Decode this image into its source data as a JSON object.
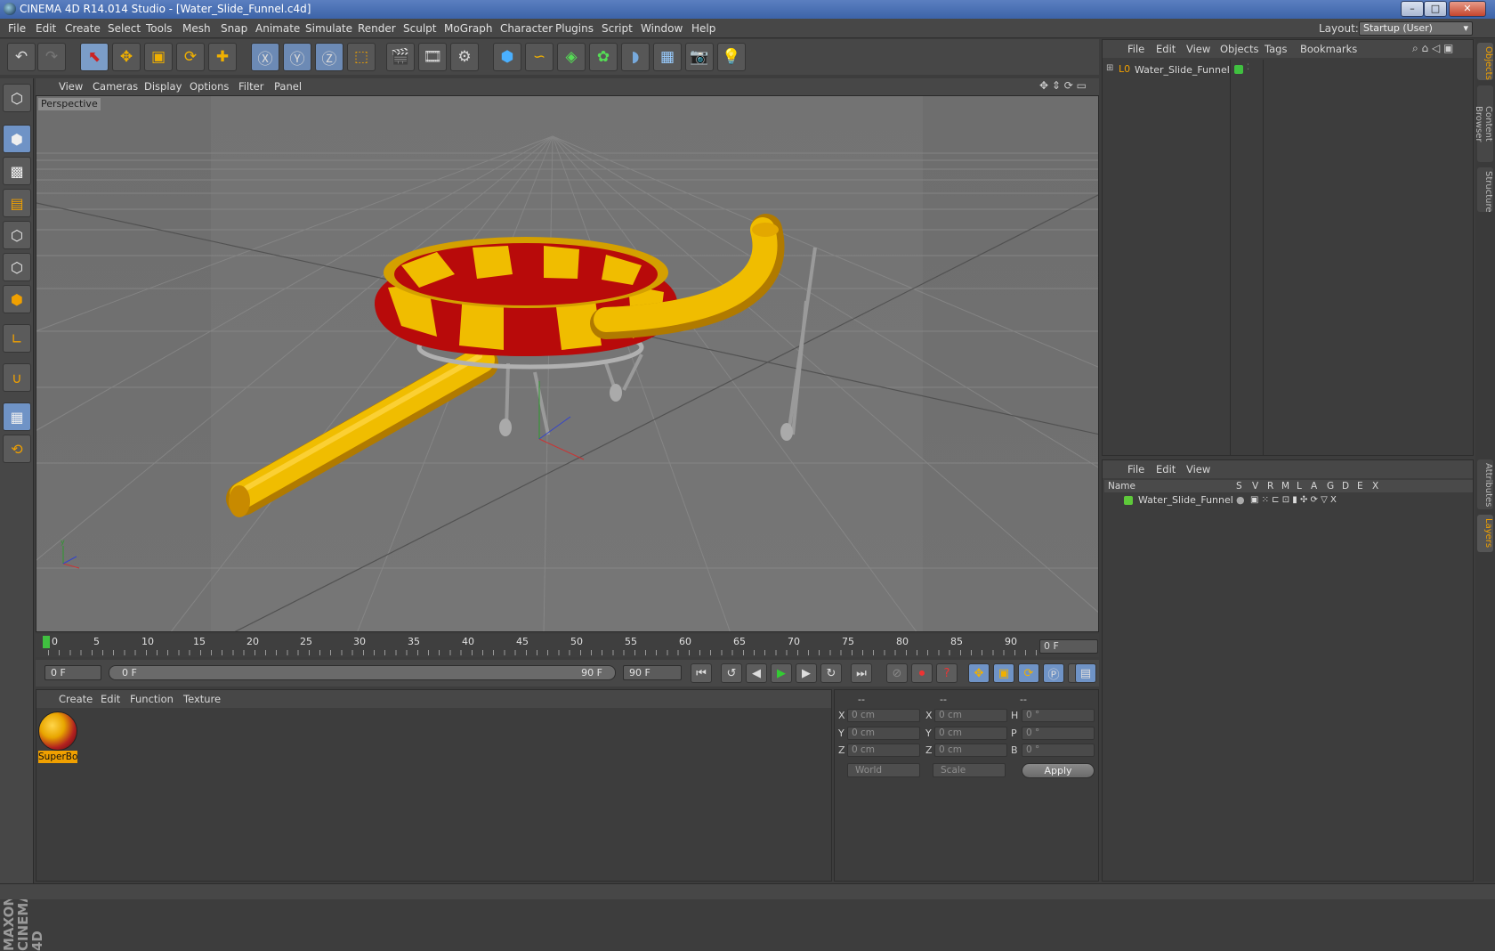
{
  "window": {
    "title": "CINEMA 4D R14.014 Studio - [Water_Slide_Funnel.c4d]",
    "minimize": "–",
    "maximize": "□",
    "close": "✕"
  },
  "menubar": {
    "items": [
      "File",
      "Edit",
      "Create",
      "Select",
      "Tools",
      "Mesh",
      "Snap",
      "Animate",
      "Simulate",
      "Render",
      "Sculpt",
      "MoGraph",
      "Character",
      "Plugins",
      "Script",
      "Window",
      "Help"
    ],
    "layout_label": "Layout:",
    "layout_value": "Startup (User)"
  },
  "viewport": {
    "menu": [
      "View",
      "Cameras",
      "Display",
      "Options",
      "Filter",
      "Panel"
    ],
    "label": "Perspective"
  },
  "timeline": {
    "ticks": [
      "0",
      "5",
      "10",
      "15",
      "20",
      "25",
      "30",
      "35",
      "40",
      "45",
      "50",
      "55",
      "60",
      "65",
      "70",
      "75",
      "80",
      "85",
      "90"
    ],
    "current_frame_right": "0 F"
  },
  "transport": {
    "start_frame": "0 F",
    "range_start": "0 F",
    "range_end": "90 F",
    "end_frame": "90 F"
  },
  "material_manager": {
    "menu": [
      "Create",
      "Edit",
      "Function",
      "Texture"
    ],
    "materials": [
      {
        "name": "SuperBo"
      }
    ]
  },
  "coordinates": {
    "col1_header": "--",
    "col2_header": "--",
    "col3_header": "--",
    "rows": [
      {
        "l1": "X",
        "v1": "0 cm",
        "l2": "X",
        "v2": "0 cm",
        "l3": "H",
        "v3": "0 °"
      },
      {
        "l1": "Y",
        "v1": "0 cm",
        "l2": "Y",
        "v2": "0 cm",
        "l3": "P",
        "v3": "0 °"
      },
      {
        "l1": "Z",
        "v1": "0 cm",
        "l2": "Z",
        "v2": "0 cm",
        "l3": "B",
        "v3": "0 °"
      }
    ],
    "space_mode": "World",
    "size_mode": "Scale",
    "apply_label": "Apply"
  },
  "object_manager": {
    "menu": [
      "File",
      "Edit",
      "View",
      "Objects",
      "Tags",
      "Bookmarks"
    ],
    "objects": [
      {
        "name": "Water_Slide_Funnel"
      }
    ]
  },
  "layer_manager": {
    "menu": [
      "File",
      "Edit",
      "View"
    ],
    "columns": [
      "Name",
      "S",
      "V",
      "R",
      "M",
      "L",
      "A",
      "G",
      "D",
      "E",
      "X"
    ],
    "layers": [
      {
        "name": "Water_Slide_Funnel",
        "color": "#5ec93a"
      }
    ]
  },
  "side_tabs": [
    "Objects",
    "Content Browser",
    "Structure",
    "Attributes",
    "Layers"
  ],
  "colors": {
    "accent": "#f0a000",
    "selection_blue": "#6f93c6",
    "slide_yellow": "#e8b400",
    "slide_red": "#b80a0a"
  }
}
